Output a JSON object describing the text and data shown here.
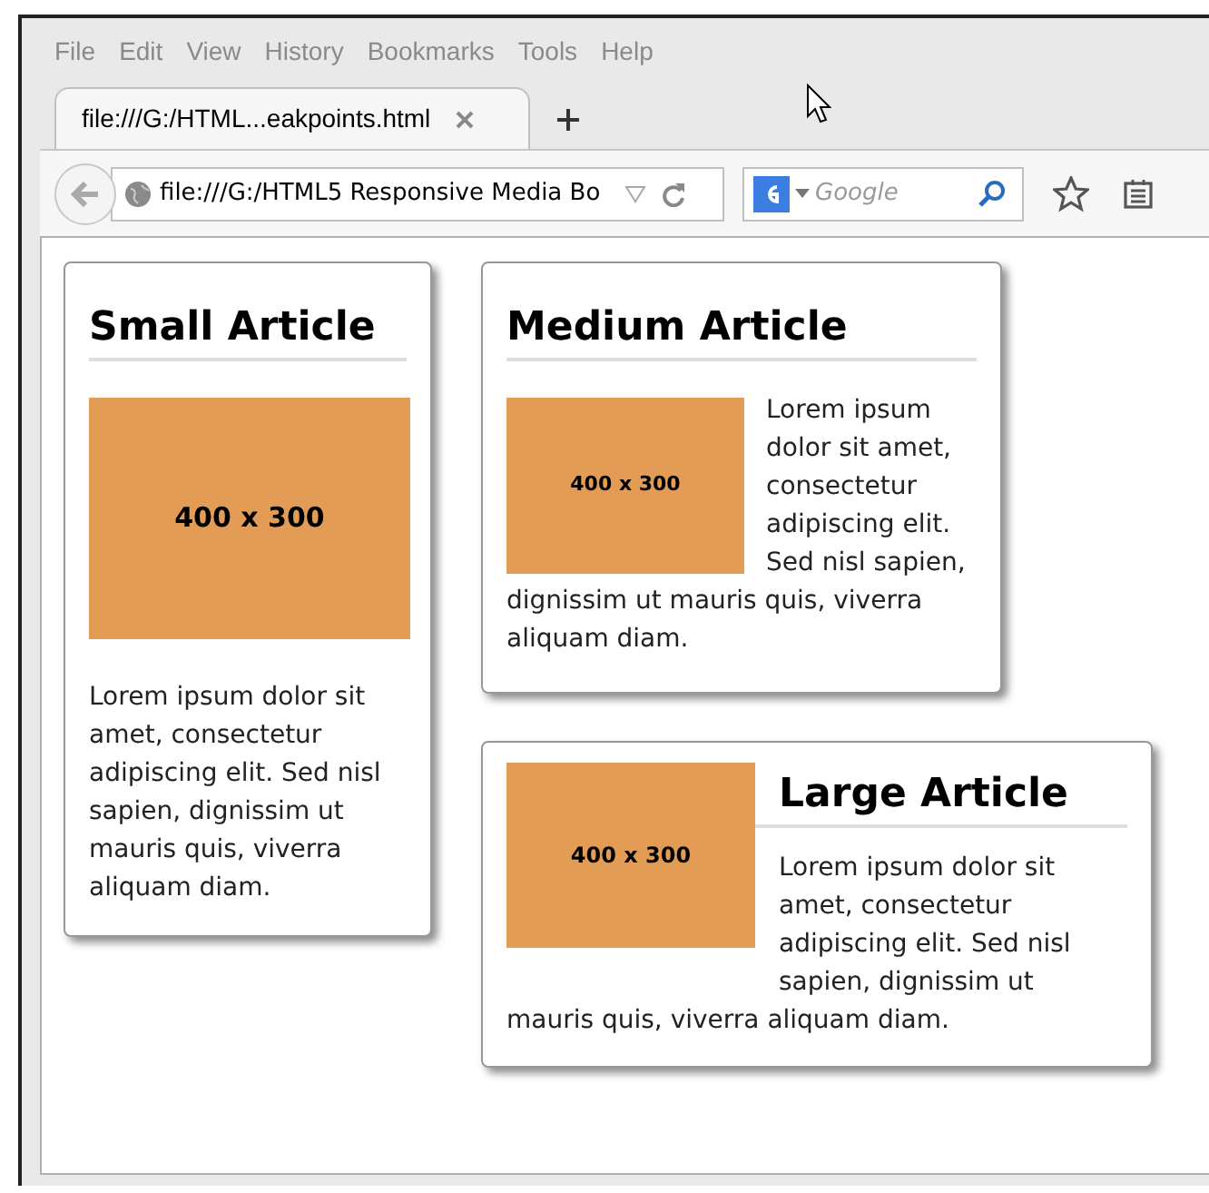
{
  "menu": [
    "File",
    "Edit",
    "View",
    "History",
    "Bookmarks",
    "Tools",
    "Help"
  ],
  "tabs": [
    {
      "title": "file:///G:/HTML...eakpoints.html",
      "selected": true
    }
  ],
  "address_bar": {
    "value": "file:///G:/HTML5 Responsive Media Bo"
  },
  "search": {
    "placeholder": "Google"
  },
  "articles": [
    {
      "kind": "small",
      "title": "Small Article",
      "image_label": "400 x 300",
      "text": "Lorem ipsum dolor sit amet, consectetur adipiscing elit. Sed nisl sapien, dignissim ut mauris quis, viverra aliquam diam."
    },
    {
      "kind": "medium",
      "title": "Medium Article",
      "image_label": "400 x 300",
      "text": "Lorem ipsum dolor sit amet, consectetur adipiscing elit. Sed nisl sapien,",
      "text_continued": "dignissim ut mauris quis, viverra aliquam diam."
    },
    {
      "kind": "large",
      "title": "Large Article",
      "image_label": "400 x 300",
      "text": "Lorem ipsum dolor sit amet, consectetur adipiscing elit. Sed nisl sapien, dignissim ut",
      "text_continued": "mauris quis, viverra aliquam diam."
    }
  ]
}
